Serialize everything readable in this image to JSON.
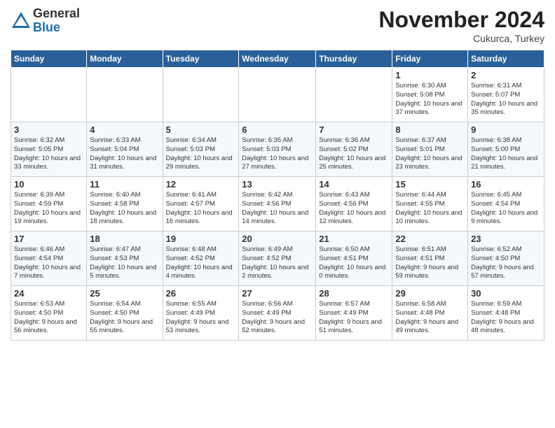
{
  "header": {
    "logo_general": "General",
    "logo_blue": "Blue",
    "month_title": "November 2024",
    "subtitle": "Cukurca, Turkey"
  },
  "weekdays": [
    "Sunday",
    "Monday",
    "Tuesday",
    "Wednesday",
    "Thursday",
    "Friday",
    "Saturday"
  ],
  "weeks": [
    [
      {
        "day": "",
        "info": ""
      },
      {
        "day": "",
        "info": ""
      },
      {
        "day": "",
        "info": ""
      },
      {
        "day": "",
        "info": ""
      },
      {
        "day": "",
        "info": ""
      },
      {
        "day": "1",
        "info": "Sunrise: 6:30 AM\nSunset: 5:08 PM\nDaylight: 10 hours and 37 minutes."
      },
      {
        "day": "2",
        "info": "Sunrise: 6:31 AM\nSunset: 5:07 PM\nDaylight: 10 hours and 35 minutes."
      }
    ],
    [
      {
        "day": "3",
        "info": "Sunrise: 6:32 AM\nSunset: 5:05 PM\nDaylight: 10 hours and 33 minutes."
      },
      {
        "day": "4",
        "info": "Sunrise: 6:33 AM\nSunset: 5:04 PM\nDaylight: 10 hours and 31 minutes."
      },
      {
        "day": "5",
        "info": "Sunrise: 6:34 AM\nSunset: 5:03 PM\nDaylight: 10 hours and 29 minutes."
      },
      {
        "day": "6",
        "info": "Sunrise: 6:35 AM\nSunset: 5:03 PM\nDaylight: 10 hours and 27 minutes."
      },
      {
        "day": "7",
        "info": "Sunrise: 6:36 AM\nSunset: 5:02 PM\nDaylight: 10 hours and 25 minutes."
      },
      {
        "day": "8",
        "info": "Sunrise: 6:37 AM\nSunset: 5:01 PM\nDaylight: 10 hours and 23 minutes."
      },
      {
        "day": "9",
        "info": "Sunrise: 6:38 AM\nSunset: 5:00 PM\nDaylight: 10 hours and 21 minutes."
      }
    ],
    [
      {
        "day": "10",
        "info": "Sunrise: 6:39 AM\nSunset: 4:59 PM\nDaylight: 10 hours and 19 minutes."
      },
      {
        "day": "11",
        "info": "Sunrise: 6:40 AM\nSunset: 4:58 PM\nDaylight: 10 hours and 18 minutes."
      },
      {
        "day": "12",
        "info": "Sunrise: 6:41 AM\nSunset: 4:57 PM\nDaylight: 10 hours and 16 minutes."
      },
      {
        "day": "13",
        "info": "Sunrise: 6:42 AM\nSunset: 4:56 PM\nDaylight: 10 hours and 14 minutes."
      },
      {
        "day": "14",
        "info": "Sunrise: 6:43 AM\nSunset: 4:56 PM\nDaylight: 10 hours and 12 minutes."
      },
      {
        "day": "15",
        "info": "Sunrise: 6:44 AM\nSunset: 4:55 PM\nDaylight: 10 hours and 10 minutes."
      },
      {
        "day": "16",
        "info": "Sunrise: 6:45 AM\nSunset: 4:54 PM\nDaylight: 10 hours and 9 minutes."
      }
    ],
    [
      {
        "day": "17",
        "info": "Sunrise: 6:46 AM\nSunset: 4:54 PM\nDaylight: 10 hours and 7 minutes."
      },
      {
        "day": "18",
        "info": "Sunrise: 6:47 AM\nSunset: 4:53 PM\nDaylight: 10 hours and 5 minutes."
      },
      {
        "day": "19",
        "info": "Sunrise: 6:48 AM\nSunset: 4:52 PM\nDaylight: 10 hours and 4 minutes."
      },
      {
        "day": "20",
        "info": "Sunrise: 6:49 AM\nSunset: 4:52 PM\nDaylight: 10 hours and 2 minutes."
      },
      {
        "day": "21",
        "info": "Sunrise: 6:50 AM\nSunset: 4:51 PM\nDaylight: 10 hours and 0 minutes."
      },
      {
        "day": "22",
        "info": "Sunrise: 6:51 AM\nSunset: 4:51 PM\nDaylight: 9 hours and 59 minutes."
      },
      {
        "day": "23",
        "info": "Sunrise: 6:52 AM\nSunset: 4:50 PM\nDaylight: 9 hours and 57 minutes."
      }
    ],
    [
      {
        "day": "24",
        "info": "Sunrise: 6:53 AM\nSunset: 4:50 PM\nDaylight: 9 hours and 56 minutes."
      },
      {
        "day": "25",
        "info": "Sunrise: 6:54 AM\nSunset: 4:50 PM\nDaylight: 9 hours and 55 minutes."
      },
      {
        "day": "26",
        "info": "Sunrise: 6:55 AM\nSunset: 4:49 PM\nDaylight: 9 hours and 53 minutes."
      },
      {
        "day": "27",
        "info": "Sunrise: 6:56 AM\nSunset: 4:49 PM\nDaylight: 9 hours and 52 minutes."
      },
      {
        "day": "28",
        "info": "Sunrise: 6:57 AM\nSunset: 4:49 PM\nDaylight: 9 hours and 51 minutes."
      },
      {
        "day": "29",
        "info": "Sunrise: 6:58 AM\nSunset: 4:48 PM\nDaylight: 9 hours and 49 minutes."
      },
      {
        "day": "30",
        "info": "Sunrise: 6:59 AM\nSunset: 4:48 PM\nDaylight: 9 hours and 48 minutes."
      }
    ]
  ]
}
